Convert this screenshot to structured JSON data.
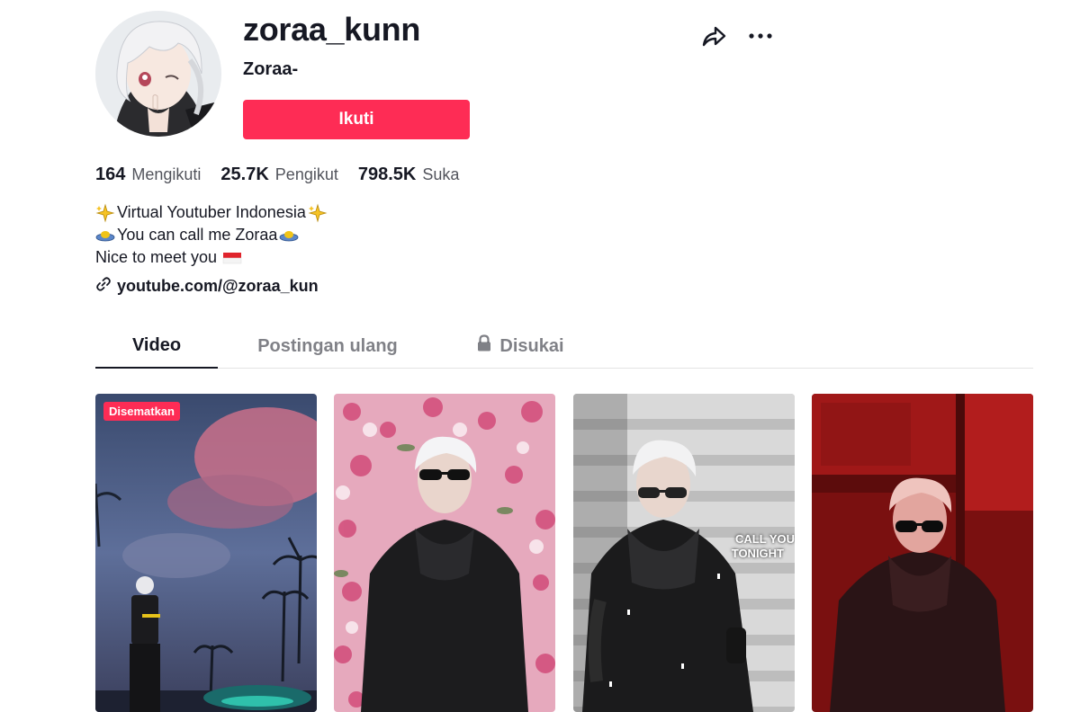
{
  "profile": {
    "username": "zoraa_kunn",
    "nickname": "Zoraa-",
    "follow_label": "Ikuti"
  },
  "stats": [
    {
      "value": "164",
      "label": "Mengikuti"
    },
    {
      "value": "25.7K",
      "label": "Pengikut"
    },
    {
      "value": "798.5K",
      "label": "Suka"
    }
  ],
  "bio": {
    "line1": "Virtual Youtuber Indonesia",
    "line2": "You can call me Zoraa",
    "line3": "Nice to meet you"
  },
  "link": {
    "text": "youtube.com/@zoraa_kun"
  },
  "tabs": {
    "video": "Video",
    "repost": "Postingan ulang",
    "liked": "Disukai"
  },
  "videos": [
    {
      "badge": "Disematkan",
      "caption": ""
    },
    {
      "badge": "",
      "caption": ""
    },
    {
      "badge": "",
      "caption_line1": "CALL YOU",
      "caption_line2": "TONIGHT"
    },
    {
      "badge": "",
      "caption": ""
    }
  ],
  "icons": {
    "share": "share-icon",
    "more": "more-icon",
    "link": "link-icon",
    "lock": "lock-icon"
  },
  "colors": {
    "accent": "#fe2c55",
    "text": "#161823"
  }
}
